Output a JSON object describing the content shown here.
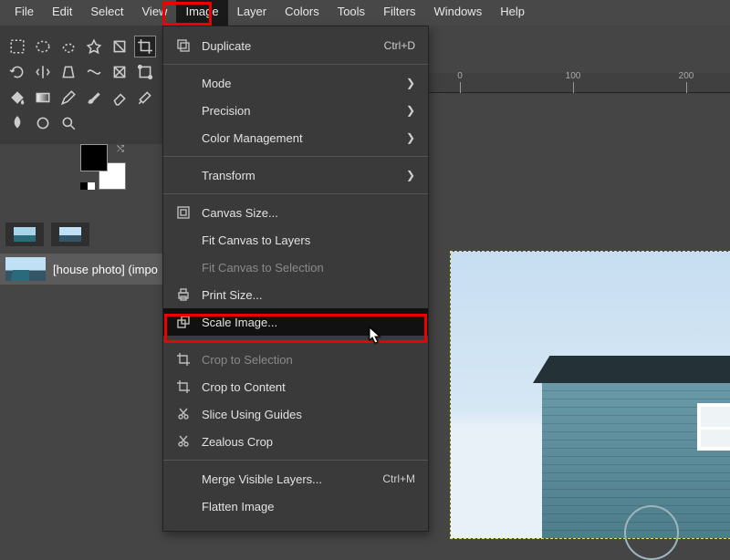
{
  "menubar": {
    "items": [
      "File",
      "Edit",
      "Select",
      "View",
      "Image",
      "Layer",
      "Colors",
      "Tools",
      "Filters",
      "Windows",
      "Help"
    ],
    "active_index": 4
  },
  "toolbox": {
    "row1": [
      "rect-select",
      "ellipse-select",
      "free-select",
      "fuzzy-select",
      "color-select",
      "crop"
    ],
    "row2": [
      "rotate",
      "flip",
      "perspective",
      "warp",
      "cage",
      "unified"
    ],
    "row3": [
      "bucket",
      "gradient",
      "pencil",
      "brush",
      "eraser",
      "airbrush"
    ],
    "row4": [
      "smudge",
      "dodge",
      "zoom"
    ],
    "active": "crop"
  },
  "layer": {
    "name": "[house photo] (impo"
  },
  "ruler": {
    "ticks": [
      {
        "pos": 34,
        "label": "0"
      },
      {
        "pos": 158,
        "label": "100"
      },
      {
        "pos": 282,
        "label": "200"
      }
    ]
  },
  "menu": {
    "groups": [
      [
        {
          "icon": "duplicate",
          "label": "Duplicate",
          "shortcut": "Ctrl+D"
        }
      ],
      [
        {
          "icon": "",
          "label": "Mode",
          "submenu": true
        },
        {
          "icon": "",
          "label": "Precision",
          "submenu": true
        },
        {
          "icon": "",
          "label": "Color Management",
          "submenu": true
        }
      ],
      [
        {
          "icon": "",
          "label": "Transform",
          "submenu": true
        }
      ],
      [
        {
          "icon": "canvas",
          "label": "Canvas Size..."
        },
        {
          "icon": "",
          "label": "Fit Canvas to Layers"
        },
        {
          "icon": "",
          "label": "Fit Canvas to Selection",
          "disabled": true
        },
        {
          "icon": "print",
          "label": "Print Size..."
        },
        {
          "icon": "scale",
          "label": "Scale Image...",
          "hover": true
        }
      ],
      [
        {
          "icon": "crop",
          "label": "Crop to Selection",
          "disabled": true
        },
        {
          "icon": "crop",
          "label": "Crop to Content"
        },
        {
          "icon": "slice",
          "label": "Slice Using Guides"
        },
        {
          "icon": "zealous",
          "label": "Zealous Crop"
        }
      ],
      [
        {
          "icon": "",
          "label": "Merge Visible Layers...",
          "shortcut": "Ctrl+M"
        },
        {
          "icon": "",
          "label": "Flatten Image"
        }
      ]
    ]
  }
}
